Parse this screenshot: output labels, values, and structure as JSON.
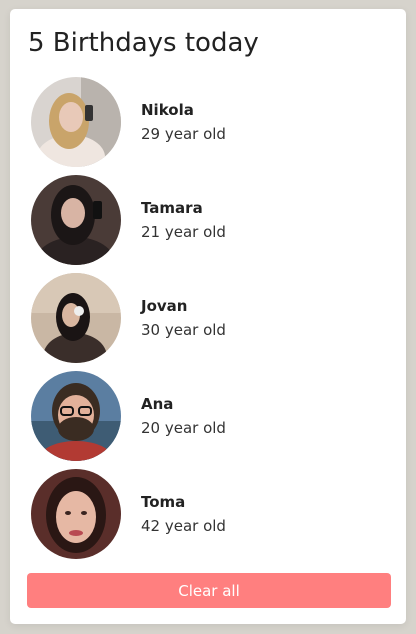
{
  "header": {
    "title": "5 Birthdays today"
  },
  "people": [
    {
      "name": "Nikola",
      "age": "29 year old",
      "photo": "nikola-photo",
      "bg": "#d9d4d0",
      "skin": "#e8c9b8",
      "hair": "#c9a46a"
    },
    {
      "name": "Tamara",
      "age": "21 year old",
      "photo": "tamara-photo",
      "bg": "#4a3b37",
      "skin": "#d8b4a4",
      "hair": "#1b1616"
    },
    {
      "name": "Jovan",
      "age": "30 year old",
      "photo": "jovan-photo",
      "bg": "#c9b7a4",
      "skin": "#d9b6a0",
      "hair": "#1a1414"
    },
    {
      "name": "Ana",
      "age": "20 year old",
      "photo": "ana-photo",
      "bg": "#5b7ea1",
      "skin": "#e2b19a",
      "hair": "#3a2c22"
    },
    {
      "name": "Toma",
      "age": "42 year old",
      "photo": "toma-photo",
      "bg": "#5a2e2a",
      "skin": "#e6b8a4",
      "hair": "#2a1714"
    }
  ],
  "actions": {
    "clear_label": "Clear all"
  },
  "colors": {
    "accent": "#ff7f7f",
    "background": "#d6d3cc",
    "card": "#ffffff"
  }
}
